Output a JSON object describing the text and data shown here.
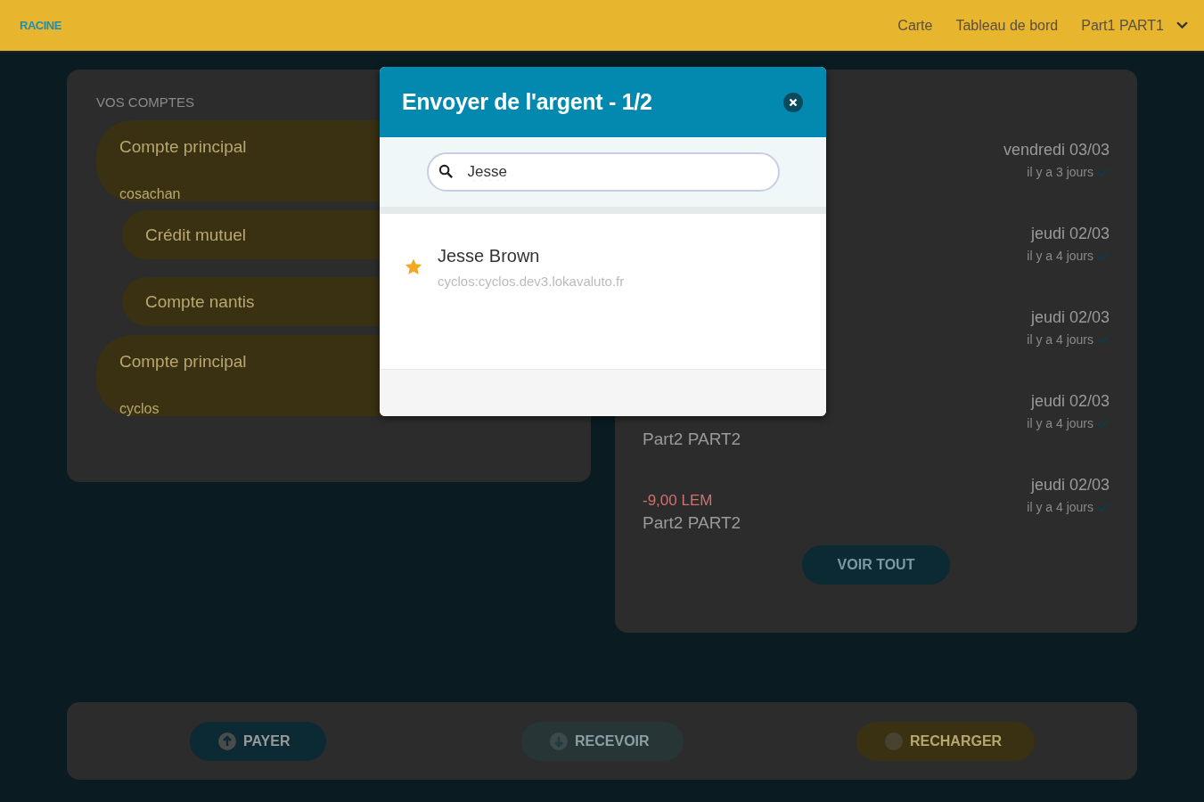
{
  "header": {
    "logo": "RACINE",
    "nav": [
      {
        "label": "Carte"
      },
      {
        "label": "Tableau de bord"
      }
    ],
    "user": "Part1 PART1"
  },
  "accounts": {
    "title": "VOS COMPTES",
    "items": [
      {
        "name": "Compte principal",
        "subtitle": "cosachan",
        "kind": "main"
      },
      {
        "name": "Crédit mutuel",
        "kind": "sub"
      },
      {
        "name": "Compte nantis",
        "kind": "sub"
      },
      {
        "name": "Compte principal",
        "subtitle": "cyclos",
        "kind": "main"
      }
    ]
  },
  "transactions": {
    "rows": [
      {
        "date": "vendredi 03/03",
        "ago": "il y a 3 jours"
      },
      {
        "date": "jeudi 02/03",
        "ago": "il y a 4 jours"
      },
      {
        "date": "jeudi 02/03",
        "ago": "il y a 4 jours"
      },
      {
        "party": "Part2 PART2",
        "date": "jeudi 02/03",
        "ago": "il y a 4 jours"
      },
      {
        "amount": "-9,00 LEM",
        "party": "Part2 PART2",
        "date": "jeudi 02/03",
        "ago": "il y a 4 jours"
      }
    ],
    "more": "VOIR TOUT"
  },
  "actions": [
    {
      "label": "PAYER",
      "kind": "pay"
    },
    {
      "label": "RECEVOIR",
      "kind": "receive"
    },
    {
      "label": "RECHARGER",
      "kind": "topup"
    }
  ],
  "dialog": {
    "title": "Envoyer de l'argent - 1/2",
    "search": {
      "value": "Jesse"
    },
    "results": [
      {
        "name": "Jesse Brown",
        "address": "cyclos:cyclos.dev3.lokavaluto.fr",
        "favorite": true
      }
    ]
  }
}
